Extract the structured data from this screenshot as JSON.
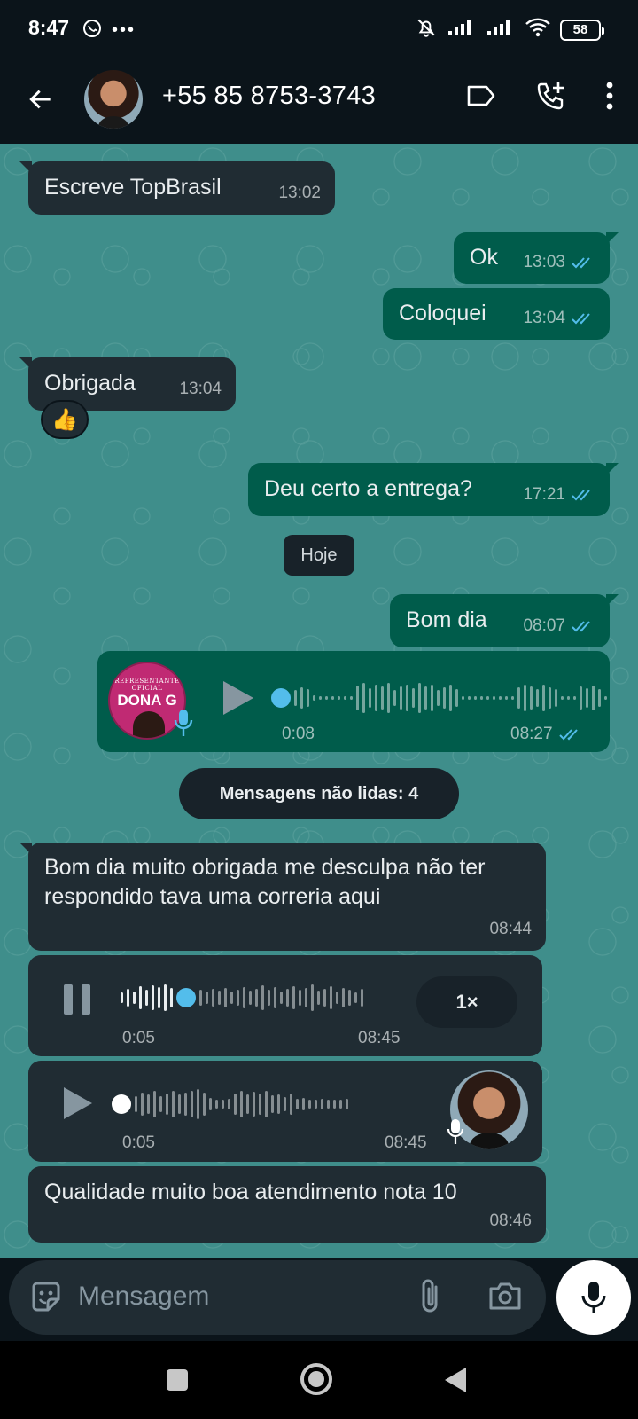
{
  "status": {
    "time": "8:47",
    "battery": "58"
  },
  "header": {
    "contact": "+55 85 8753-3743"
  },
  "messages": [
    {
      "text": "Escreve TopBrasil",
      "time": "13:02"
    },
    {
      "text": "Ok",
      "time": "13:03"
    },
    {
      "text": "Coloquei",
      "time": "13:04"
    },
    {
      "text": "Obrigada",
      "time": "13:04",
      "reaction": "👍"
    },
    {
      "text": "Deu certo a entrega?",
      "time": "17:21"
    },
    {
      "text": "Bom dia",
      "time": "08:07"
    },
    {
      "text": "Bom dia muito obrigada me desculpa não ter respondido tava uma correria aqui",
      "time": "08:44"
    },
    {
      "text": "Qualidade muito boa atendimento nota 10",
      "time": "08:46"
    }
  ],
  "date_chip": "Hoje",
  "unread_label": "Mensagens não lidas: 4",
  "voice_out": {
    "duration": "0:08",
    "time": "08:27",
    "avatar_line1": "REPRESENTANTE OFICIAL",
    "avatar_line2": "DONA G"
  },
  "voice_in_1": {
    "position": "0:05",
    "time": "08:45",
    "speed": "1×"
  },
  "voice_in_2": {
    "duration": "0:05",
    "time": "08:45"
  },
  "composer": {
    "placeholder": "Mensagem"
  },
  "colors": {
    "incoming": "#202c33",
    "outgoing": "#005c4b",
    "read_ticks": "#53bdeb",
    "wallpaper": "#3f8e8b"
  }
}
